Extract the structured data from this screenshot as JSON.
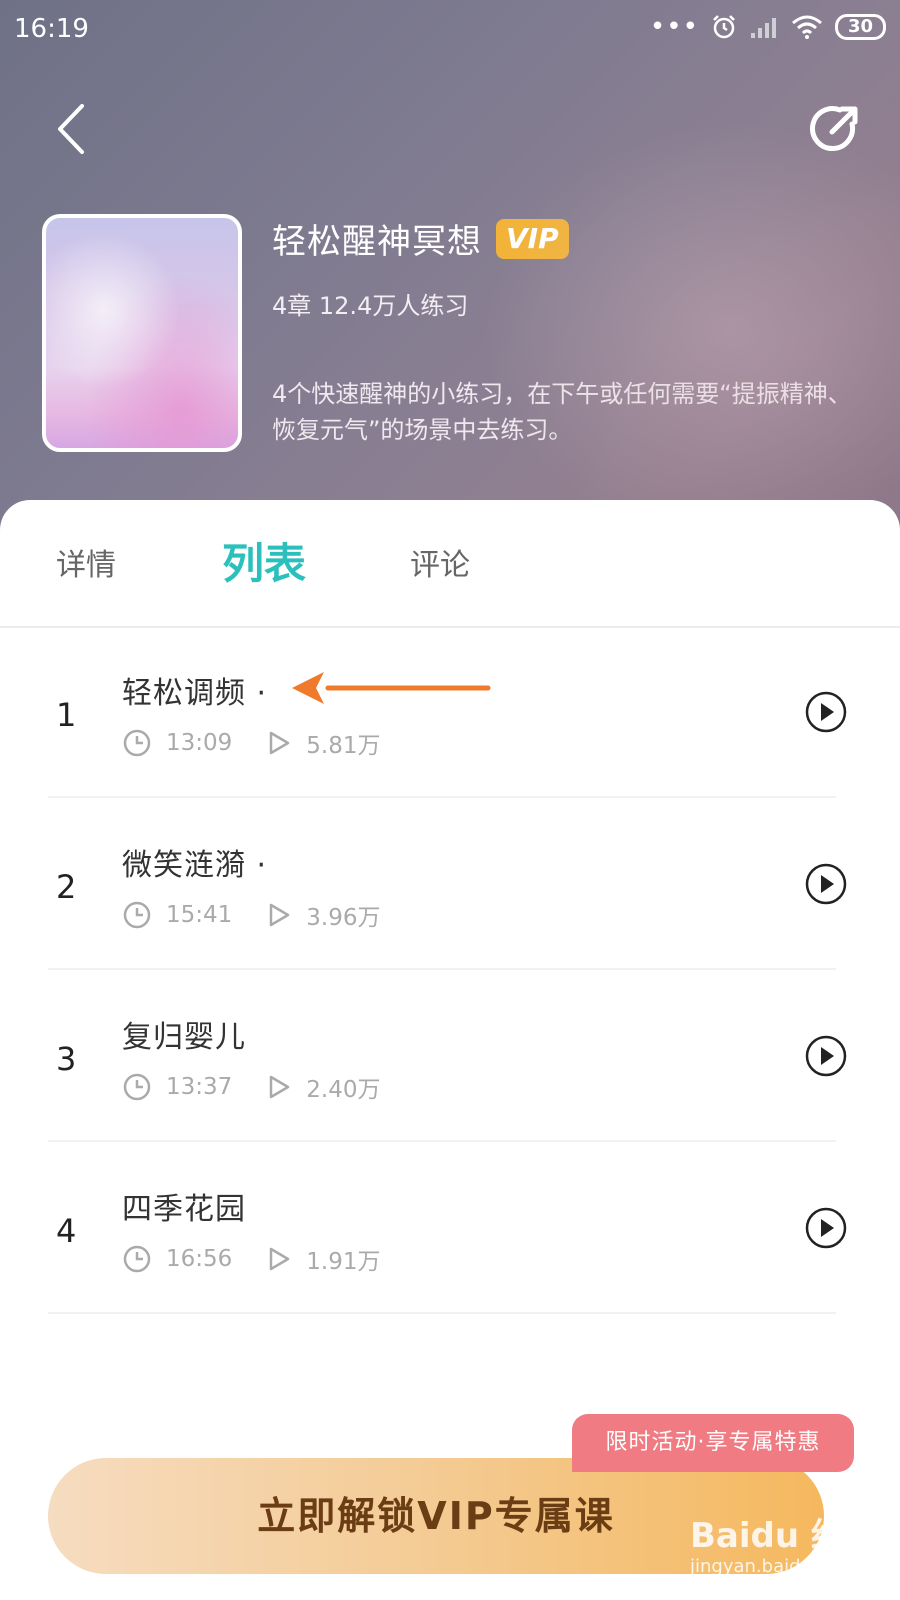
{
  "status_bar": {
    "time": "16:19",
    "dots": "•••",
    "battery": "30"
  },
  "course": {
    "title": "轻松醒神冥想",
    "badge": "VIP",
    "subtitle": "4章 12.4万人练习",
    "description": "4个快速醒神的小练习，在下午或任何需要“提振精神、恢复元气”的场景中去练习。"
  },
  "tabs": [
    {
      "label": "详情",
      "active": false
    },
    {
      "label": "列表",
      "active": true
    },
    {
      "label": "评论",
      "active": false
    }
  ],
  "tracks": [
    {
      "index": "1",
      "title": "轻松调频 ·",
      "duration": "13:09",
      "plays": "5.81万"
    },
    {
      "index": "2",
      "title": "微笑涟漪 ·",
      "duration": "15:41",
      "plays": "3.96万"
    },
    {
      "index": "3",
      "title": "复归婴儿",
      "duration": "13:37",
      "plays": "2.40万"
    },
    {
      "index": "4",
      "title": "四季花园",
      "duration": "16:56",
      "plays": "1.91万"
    }
  ],
  "promo": {
    "tag": "限时活动·享专属特惠",
    "button": "立即解锁VIP专属课"
  },
  "watermark": {
    "brand": "Baidu 经验",
    "url": "jingyan.baidu.com"
  },
  "colors": {
    "accent": "#2cc0bd",
    "vip": "#f2b338",
    "promo": "#f07b82",
    "arrow": "#f07a2c"
  }
}
